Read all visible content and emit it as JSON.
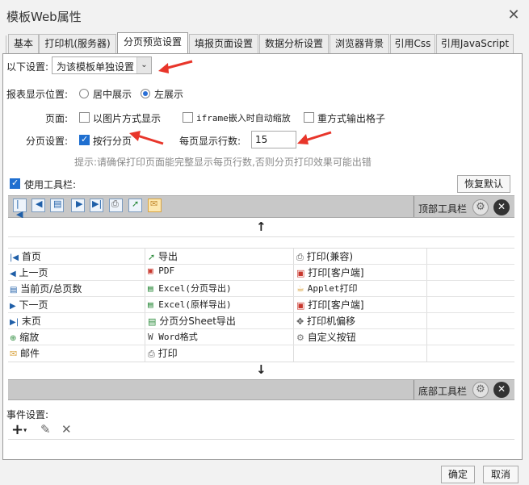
{
  "window": {
    "title": "模板Web属性"
  },
  "tabs": [
    {
      "label": "基本"
    },
    {
      "label": "打印机(服务器)"
    },
    {
      "label": "分页预览设置"
    },
    {
      "label": "填报页面设置"
    },
    {
      "label": "数据分析设置"
    },
    {
      "label": "浏览器背景"
    },
    {
      "label": "引用Css"
    },
    {
      "label": "引用JavaScript"
    }
  ],
  "settings": {
    "mode_label": "以下设置:",
    "mode_value": "为该模板单独设置",
    "position_label": "报表显示位置:",
    "position_center": "居中展示",
    "position_left": "左展示",
    "page_label": "页面:",
    "page_opt1": "以图片方式显示",
    "page_opt2": "iframe嵌入时自动缩放",
    "page_opt3": "重方式输出格子",
    "paging_label": "分页设置:",
    "paging_by_row": "按行分页",
    "rows_per_page_label": "每页显示行数:",
    "rows_per_page_value": "15",
    "hint": "提示:请确保打印页面能完整显示每页行数,否则分页打印效果可能出错",
    "use_toolbar": "使用工具栏:",
    "restore_default": "恢复默认"
  },
  "top_toolbar_label": "顶部工具栏",
  "bottom_toolbar_label": "底部工具栏",
  "button_grid": [
    [
      "首页",
      "导出",
      "打印(兼容)"
    ],
    [
      "上一页",
      "PDF",
      "打印[客户端]"
    ],
    [
      "当前页/总页数",
      "Excel(分页导出)",
      "Applet打印"
    ],
    [
      "下一页",
      "Excel(原样导出)",
      "打印[客户端]"
    ],
    [
      "末页",
      "分页分Sheet导出",
      "打印机偏移"
    ],
    [
      "缩放",
      "Word格式",
      "自定义按钮"
    ],
    [
      "邮件",
      "打印",
      ""
    ]
  ],
  "events_label": "事件设置:",
  "footer": {
    "ok": "确定",
    "cancel": "取消"
  },
  "colors": {
    "accent": "#1f6fd0",
    "arrow": "#e8352a",
    "toolbar_bg": "#c8c8c8"
  }
}
